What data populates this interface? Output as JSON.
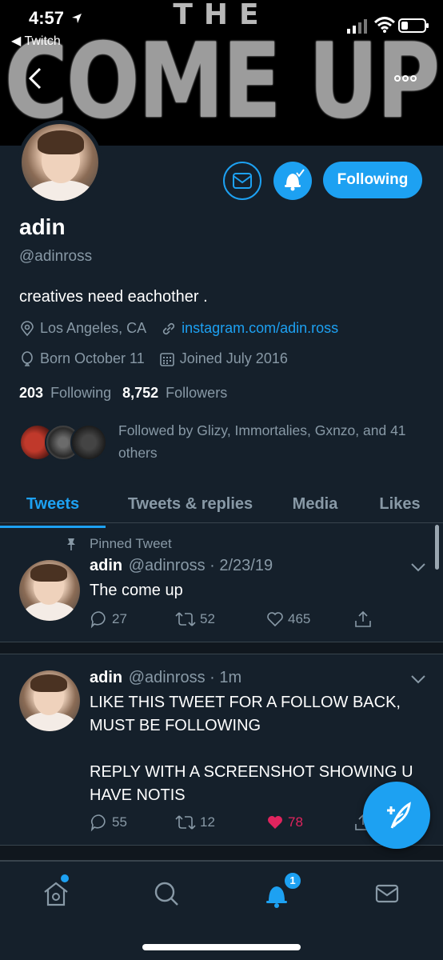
{
  "status_bar": {
    "time": "4:57",
    "back_app": "Twitch"
  },
  "banner": {
    "line1": "THE",
    "line2": "COME UP"
  },
  "profile": {
    "name": "adin",
    "handle": "@adinross",
    "bio": "creatives need eachother .",
    "location": "Los Angeles, CA",
    "website": "instagram.com/adin.ross",
    "birthday": "Born October 11",
    "joined": "Joined July 2016",
    "following_count": "203",
    "following_label": "Following",
    "followers_count": "8,752",
    "followers_label": "Followers",
    "followed_by": "Followed by Glizy, Immortalies, Gxnzo, and 41 others",
    "follow_button_label": "Following"
  },
  "tabs": [
    {
      "label": "Tweets",
      "active": true
    },
    {
      "label": "Tweets & replies",
      "active": false
    },
    {
      "label": "Media",
      "active": false
    },
    {
      "label": "Likes",
      "active": false
    }
  ],
  "tweets": [
    {
      "pinned_label": "Pinned Tweet",
      "name": "adin",
      "handle": "@adinross",
      "time": "· 2/23/19",
      "text": "The come up",
      "replies": "27",
      "retweets": "52",
      "likes": "465",
      "liked": false
    },
    {
      "name": "adin",
      "handle": "@adinross",
      "time": "· 1m",
      "text": "LIKE THIS TWEET FOR A FOLLOW BACK, MUST BE FOLLOWING\n\nREPLY WITH A SCREENSHOT SHOWING U HAVE NOTIS",
      "replies": "55",
      "retweets": "12",
      "likes": "78",
      "liked": true
    }
  ],
  "bottom_nav": {
    "notifications_badge": "1"
  },
  "colors": {
    "background": "#15202b",
    "accent": "#1da1f2",
    "muted": "#8899a6",
    "like": "#e0245e"
  }
}
